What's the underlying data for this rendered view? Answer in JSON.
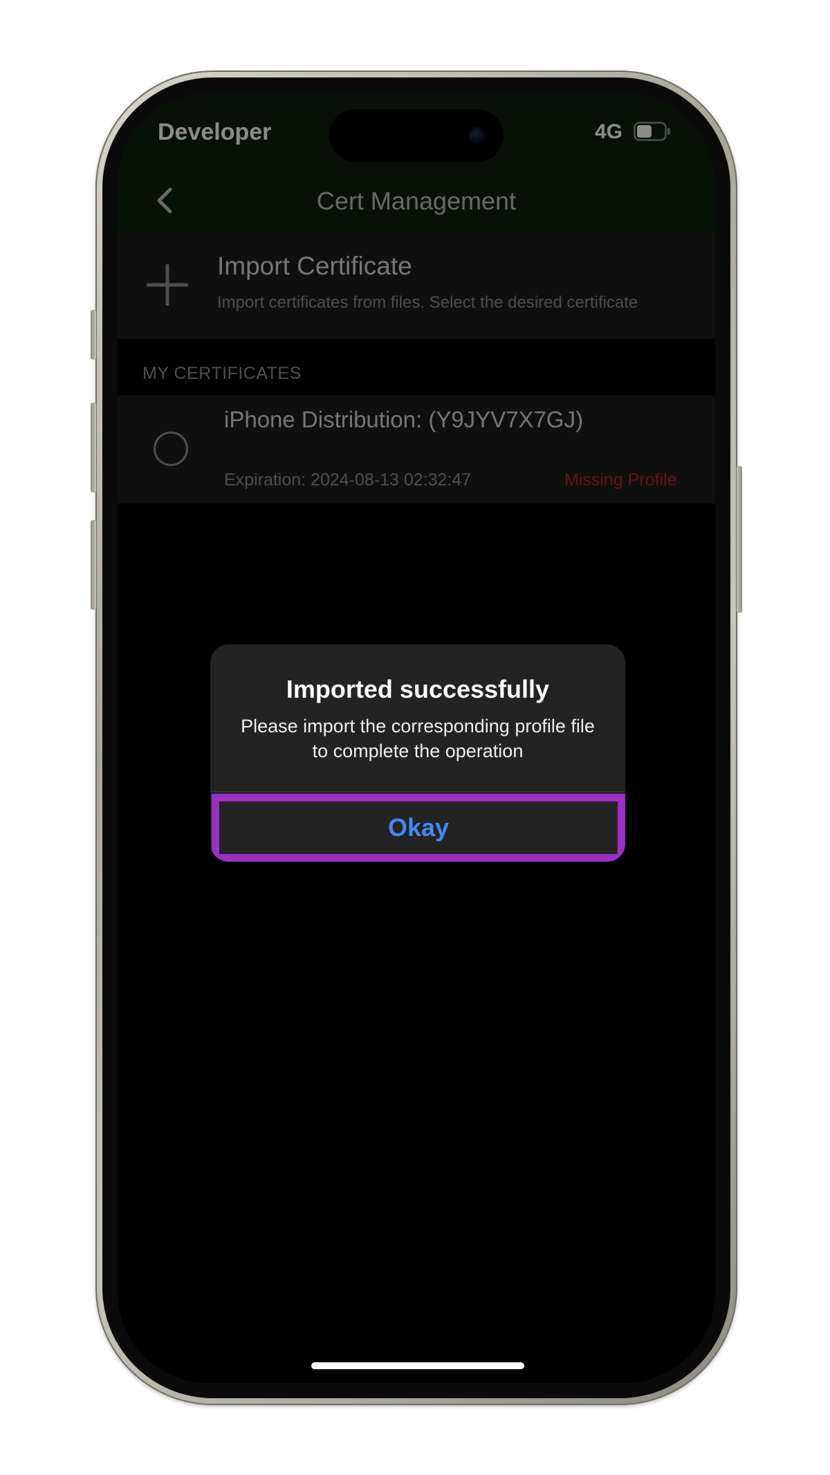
{
  "status_bar": {
    "carrier": "Developer",
    "network": "4G",
    "battery_level": 0.55
  },
  "nav": {
    "title": "Cert Management"
  },
  "import_row": {
    "title": "Import Certificate",
    "description": "Import certificates from files. Select the desired certificate"
  },
  "section": {
    "header": "MY CERTIFICATES"
  },
  "certificates": [
    {
      "name": "iPhone Distribution:  (Y9JYV7X7GJ)",
      "expiration": "Expiration: 2024-08-13 02:32:47",
      "status": "Missing Profile",
      "selected": false
    }
  ],
  "alert": {
    "title": "Imported successfully",
    "message": "Please import the corresponding profile file to complete the operation",
    "button_label": "Okay"
  },
  "colors": {
    "header_bg": "#10200f",
    "accent_link": "#3f8bf2",
    "highlight_border": "#9b2fc4",
    "status_error": "#b3262b"
  }
}
